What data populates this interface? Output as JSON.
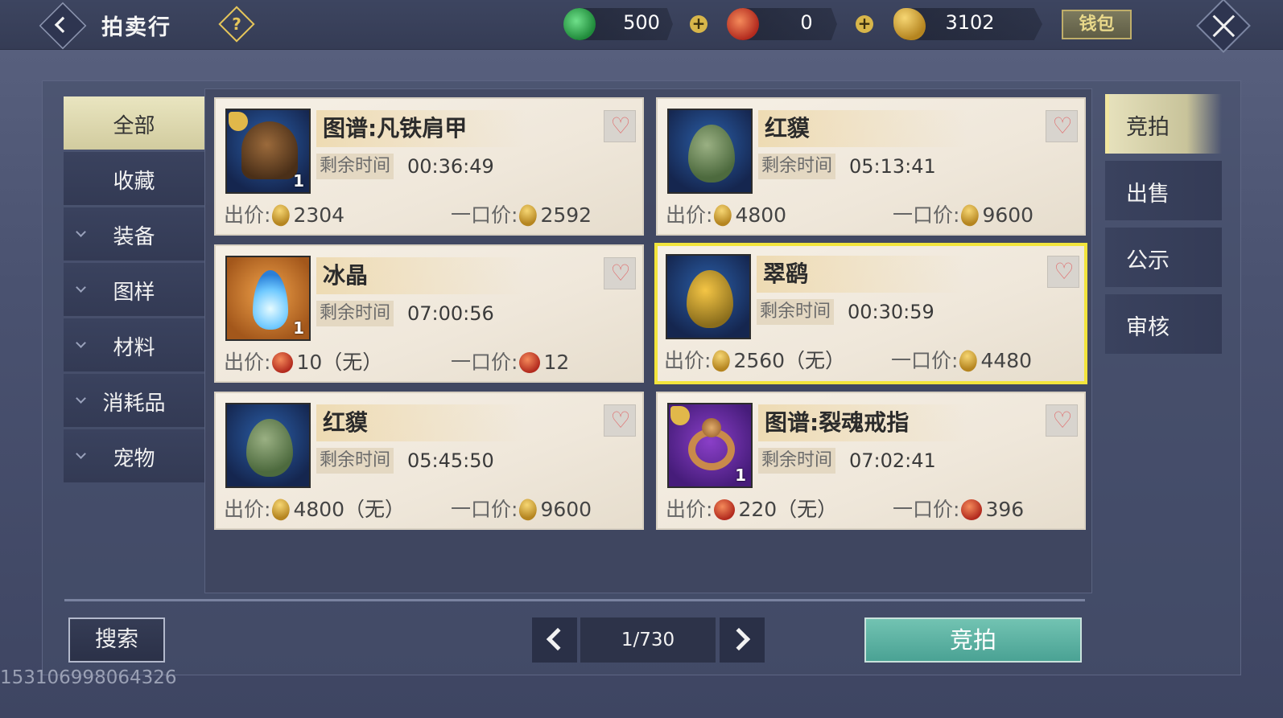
{
  "header": {
    "title": "拍卖行",
    "currencies": [
      {
        "icon": "jade-coin-icon",
        "value": "500",
        "has_plus": true
      },
      {
        "icon": "red-swirl-coin-icon",
        "value": "0",
        "has_plus": true
      },
      {
        "icon": "gold-seed-coin-icon",
        "value": "3102",
        "has_plus": false
      }
    ],
    "wallet_label": "钱包"
  },
  "sidebar": {
    "items": [
      {
        "label": "全部",
        "active": true,
        "expandable": false
      },
      {
        "label": "收藏",
        "active": false,
        "expandable": false
      },
      {
        "label": "装备",
        "active": false,
        "expandable": true
      },
      {
        "label": "图样",
        "active": false,
        "expandable": true
      },
      {
        "label": "材料",
        "active": false,
        "expandable": true
      },
      {
        "label": "消耗品",
        "active": false,
        "expandable": true
      },
      {
        "label": "宠物",
        "active": false,
        "expandable": true
      }
    ]
  },
  "listing": {
    "time_label": "剩余时间",
    "bid_label": "出价:",
    "buyout_label": "一口价:",
    "items": [
      {
        "name": "图谱:凡铁肩甲",
        "time": "00:36:49",
        "bid": "2304",
        "bid_currency": "gold",
        "buyout": "2592",
        "buyout_currency": "gold",
        "qty": "1",
        "icon": "helmet-icon",
        "selected": false
      },
      {
        "name": "红貘",
        "time": "05:13:41",
        "bid": "4800",
        "bid_currency": "gold",
        "buyout": "9600",
        "buyout_currency": "gold",
        "qty": "",
        "icon": "green-egg-icon",
        "selected": false
      },
      {
        "name": "冰晶",
        "time": "07:00:56",
        "bid": "10（无）",
        "bid_currency": "red",
        "buyout": "12",
        "buyout_currency": "red",
        "qty": "1",
        "icon": "ice-flame-icon",
        "selected": false
      },
      {
        "name": "翠鹞",
        "time": "00:30:59",
        "bid": "2560（无）",
        "bid_currency": "gold",
        "buyout": "4480",
        "buyout_currency": "gold",
        "qty": "",
        "icon": "yellow-egg-icon",
        "selected": true
      },
      {
        "name": "红貘",
        "time": "05:45:50",
        "bid": "4800（无）",
        "bid_currency": "gold",
        "buyout": "9600",
        "buyout_currency": "gold",
        "qty": "",
        "icon": "green-egg-icon",
        "selected": false
      },
      {
        "name": "图谱:裂魂戒指",
        "time": "07:02:41",
        "bid": "220（无）",
        "bid_currency": "red",
        "buyout": "396",
        "buyout_currency": "red",
        "qty": "1",
        "icon": "ring-icon",
        "selected": false
      }
    ]
  },
  "tabs": [
    {
      "label": "竞拍",
      "active": true
    },
    {
      "label": "出售",
      "active": false
    },
    {
      "label": "公示",
      "active": false
    },
    {
      "label": "审核",
      "active": false
    }
  ],
  "footer": {
    "search_label": "搜索",
    "page": "1/730",
    "bid_button_label": "竞拍",
    "uid": "153106998064326"
  },
  "colors": {
    "selected_border": "#f2e43c",
    "bid_button": "#5fb5a5",
    "active_menu": "#e0dcb5"
  }
}
